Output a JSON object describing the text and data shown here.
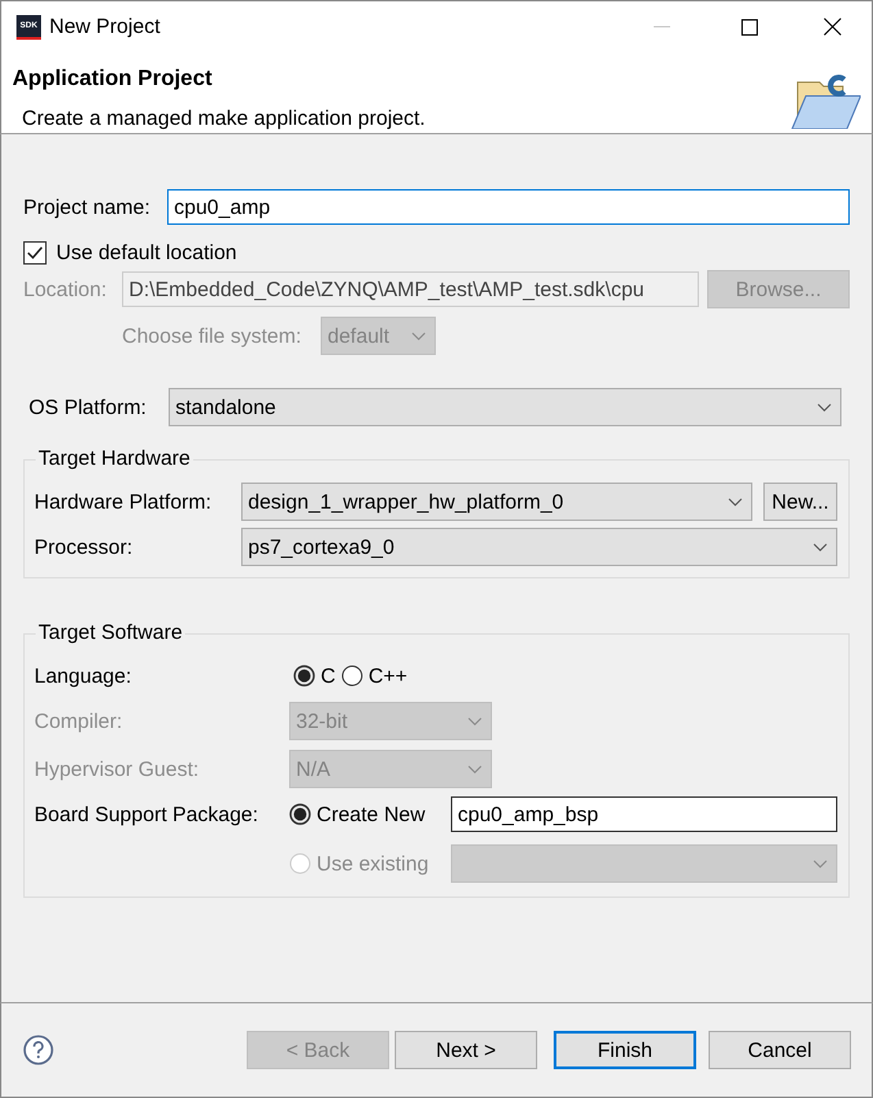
{
  "window": {
    "app_icon": "SDK",
    "title": "New Project"
  },
  "header": {
    "title": "Application Project",
    "description": "Create a managed make application project."
  },
  "project_name": {
    "label": "Project name:",
    "value": "cpu0_amp",
    "focused": true
  },
  "use_default_location": {
    "label": "Use default location",
    "checked": true
  },
  "location": {
    "label": "Location:",
    "value": "D:\\Embedded_Code\\ZYNQ\\AMP_test\\AMP_test.sdk\\cpu",
    "disabled": true,
    "button": "Browse..."
  },
  "file_system": {
    "label": "Choose file system:",
    "value": "default",
    "disabled": true
  },
  "os_platform": {
    "label": "OS Platform:",
    "value": "standalone"
  },
  "target_hardware": {
    "title": "Target Hardware",
    "fields": [
      {
        "label": "Hardware Platform:",
        "value": "design_1_wrapper_hw_platform_0",
        "button": "New..."
      },
      {
        "label": "Processor:",
        "value": "ps7_cortexa9_0"
      }
    ]
  },
  "target_software": {
    "title": "Target Software",
    "language": {
      "label": "Language:",
      "options": [
        {
          "label": "C",
          "selected": true
        },
        {
          "label": "C++",
          "selected": false
        }
      ]
    },
    "compiler": {
      "label": "Compiler:",
      "value": "32-bit",
      "disabled": true
    },
    "hypervisor": {
      "label": "Hypervisor Guest:",
      "value": "N/A",
      "disabled": true
    },
    "bsp": {
      "label": "Board Support Package:",
      "options": [
        {
          "kind": "text",
          "label": "Create New",
          "selected": true,
          "disabled": false,
          "value": "cpu0_amp_bsp"
        },
        {
          "kind": "combo",
          "label": "Use existing",
          "selected": false,
          "disabled": true
        }
      ]
    }
  },
  "buttons": [
    {
      "label": "< Back",
      "disabled": true,
      "default": false
    },
    {
      "label": "Next >",
      "disabled": false,
      "default": false
    },
    {
      "label": "Finish",
      "disabled": false,
      "default": true
    },
    {
      "label": "Cancel",
      "disabled": false,
      "default": false
    }
  ]
}
